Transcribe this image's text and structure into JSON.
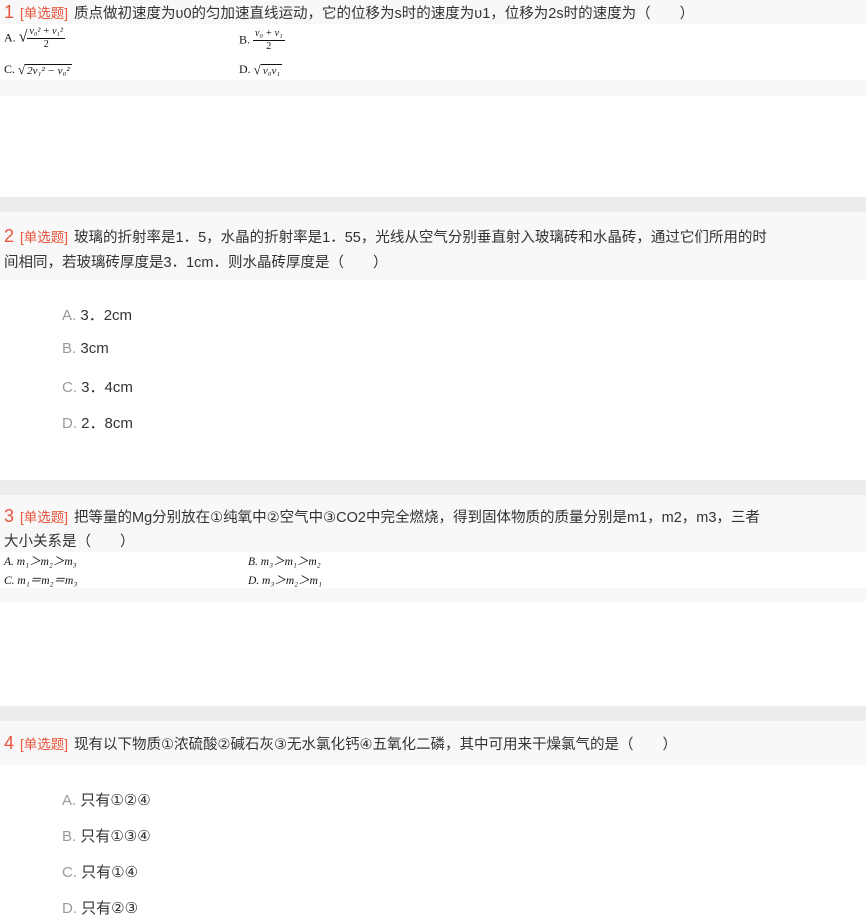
{
  "questions": [
    {
      "number": "1",
      "type": "[单选题]",
      "text": "质点做初速度为υ0的匀加速直线运动，它的位移为s时的速度为υ1，位移为2s时的速度为（　　）",
      "options_image": {
        "a_label": "A.",
        "a_numer": "v₀² + v₁²",
        "a_denom": "2",
        "b_label": "B.",
        "b_numer": "v₀ + v₁",
        "b_denom": "2",
        "c_label": "C.",
        "c_expr": "2v₁² − v₀²",
        "d_label": "D.",
        "d_expr": "v₀v₁"
      }
    },
    {
      "number": "2",
      "type": "[单选题]",
      "text_line1": "玻璃的折射率是1．5，水晶的折射率是1．55，光线从空气分别垂直射入玻璃砖和水晶砖，通过它们所用的时",
      "text_line2": "间相同，若玻璃砖厚度是3．1cm．则水晶砖厚度是（　　）",
      "options": [
        {
          "letter": "A.",
          "text": "3．2cm"
        },
        {
          "letter": "B.",
          "text": "3cm"
        },
        {
          "letter": "C.",
          "text": "3．4cm"
        },
        {
          "letter": "D.",
          "text": "2．8cm"
        }
      ]
    },
    {
      "number": "3",
      "type": "[单选题]",
      "text_line1": "把等量的Mg分别放在①纯氧中②空气中③CO2中完全燃烧，得到固体物质的质量分别是m1，m2，m3，三者",
      "text_line2": "大小关系是（　　）",
      "options_image": {
        "a": "A. m₁＞m₂＞m₃",
        "b": "B. m₃＞m₁＞m₂",
        "c": "C. m₁＝m₂＝m₃",
        "d": "D. m₃＞m₂＞m₁"
      }
    },
    {
      "number": "4",
      "type": "[单选题]",
      "text": "现有以下物质①浓硫酸②碱石灰③无水氯化钙④五氧化二磷，其中可用来干燥氯气的是（　　）",
      "options": [
        {
          "letter": "A.",
          "text": "只有①②④"
        },
        {
          "letter": "B.",
          "text": "只有①③④"
        },
        {
          "letter": "C.",
          "text": "只有①④"
        },
        {
          "letter": "D.",
          "text": "只有②③"
        }
      ]
    }
  ]
}
